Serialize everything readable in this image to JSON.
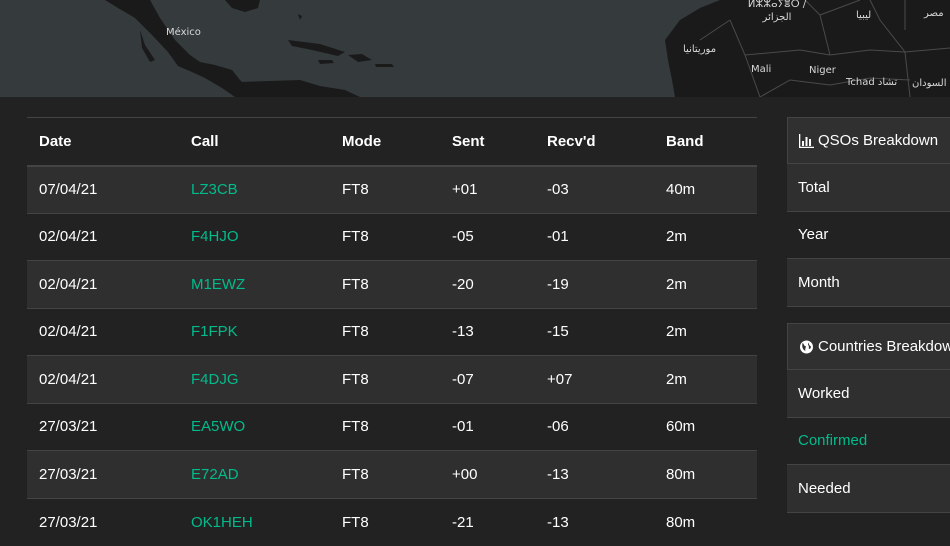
{
  "map": {
    "labels": {
      "mexico": "México",
      "algeria": "ⵍⵣⵣⴰⵢⴻⵔ / الجزائر",
      "libya": "ليبيا",
      "egypt": "مصر",
      "mauritania": "موريتانيا",
      "mali": "Mali",
      "niger": "Niger",
      "chad": "Tchad تشاد",
      "sudan": "السودان"
    }
  },
  "table": {
    "headers": {
      "date": "Date",
      "call": "Call",
      "mode": "Mode",
      "sent": "Sent",
      "recvd": "Recv'd",
      "band": "Band"
    },
    "rows": [
      {
        "date": "07/04/21",
        "call": "LZ3CB",
        "mode": "FT8",
        "sent": "+01",
        "recvd": "-03",
        "band": "40m"
      },
      {
        "date": "02/04/21",
        "call": "F4HJO",
        "mode": "FT8",
        "sent": "-05",
        "recvd": "-01",
        "band": "2m"
      },
      {
        "date": "02/04/21",
        "call": "M1EWZ",
        "mode": "FT8",
        "sent": "-20",
        "recvd": "-19",
        "band": "2m"
      },
      {
        "date": "02/04/21",
        "call": "F1FPK",
        "mode": "FT8",
        "sent": "-13",
        "recvd": "-15",
        "band": "2m"
      },
      {
        "date": "02/04/21",
        "call": "F4DJG",
        "mode": "FT8",
        "sent": "-07",
        "recvd": "+07",
        "band": "2m"
      },
      {
        "date": "27/03/21",
        "call": "EA5WO",
        "mode": "FT8",
        "sent": "-01",
        "recvd": "-06",
        "band": "60m"
      },
      {
        "date": "27/03/21",
        "call": "E72AD",
        "mode": "FT8",
        "sent": "+00",
        "recvd": "-13",
        "band": "80m"
      },
      {
        "date": "27/03/21",
        "call": "OK1HEH",
        "mode": "FT8",
        "sent": "-21",
        "recvd": "-13",
        "band": "80m"
      }
    ]
  },
  "qsos_panel": {
    "title": "QSOs Breakdown",
    "icon": "bar-chart-icon",
    "items": [
      "Total",
      "Year",
      "Month"
    ]
  },
  "countries_panel": {
    "title": "Countries Breakdown",
    "icon": "globe-icon",
    "items": [
      {
        "label": "Worked",
        "color": "#ffffff"
      },
      {
        "label": "Confirmed",
        "color": "#00bc8c"
      },
      {
        "label": "Needed",
        "color": "#ffffff"
      }
    ]
  },
  "colors": {
    "accent": "#00bc8c",
    "background": "#222222",
    "stripe": "#2f2f2f"
  }
}
